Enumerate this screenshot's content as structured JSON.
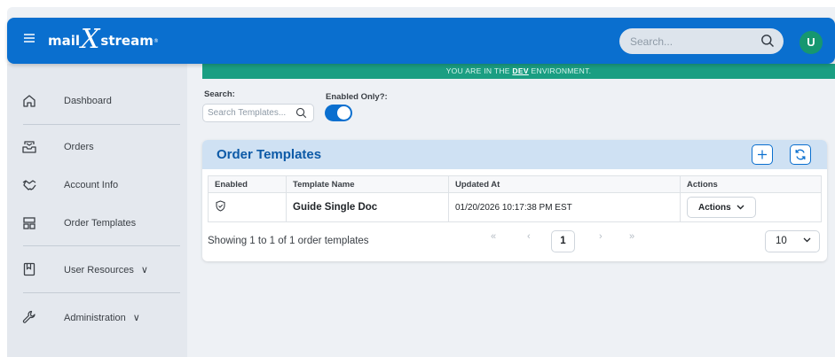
{
  "header": {
    "logo_left": "mail",
    "logo_x": "X",
    "logo_right": "stream",
    "logo_mark": "®",
    "search_placeholder": "Search...",
    "avatar_initial": "U",
    "brand_color": "#0a6fcf"
  },
  "environment": {
    "prefix": "YOU ARE IN THE ",
    "env": "DEV",
    "suffix": " ENVIRONMENT."
  },
  "sidebar": {
    "items": [
      {
        "label": "Dashboard",
        "icon": "home-icon"
      },
      {
        "label": "Orders",
        "icon": "inbox-icon"
      },
      {
        "label": "Account Info",
        "icon": "handshake-icon"
      },
      {
        "label": "Order Templates",
        "icon": "layout-icon"
      },
      {
        "label": "User Resources",
        "icon": "book-icon",
        "chevron": "∨"
      },
      {
        "label": "Administration",
        "icon": "wrench-icon",
        "chevron": "∨"
      }
    ]
  },
  "filters": {
    "search_label": "Search:",
    "search_placeholder": "Search Templates...",
    "enabled_label": "Enabled Only?:",
    "enabled_on": true
  },
  "card": {
    "title": "Order Templates",
    "columns": [
      "Enabled",
      "Template Name",
      "Updated At",
      "Actions"
    ],
    "rows": [
      {
        "template_name": "Guide Single Doc",
        "updated_at": "01/20/2026 10:17:38 PM EST",
        "actions_label": "Actions"
      }
    ],
    "showing_text": "Showing 1 to 1 of 1 order templates",
    "pager": {
      "first": "«",
      "prev": "‹",
      "current": "1",
      "next": "›",
      "last": "»"
    },
    "per_page": "10"
  }
}
